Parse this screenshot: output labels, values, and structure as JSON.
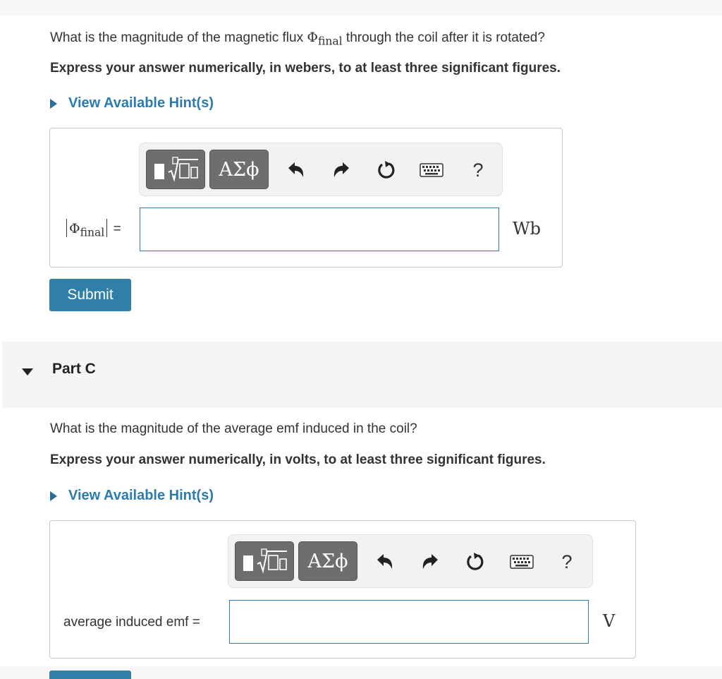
{
  "partB": {
    "question_before": "What is the magnitude of the magnetic flux ",
    "question_symbol": "Φ",
    "question_sub": "final",
    "question_after": " through the coil after it is rotated?",
    "instruction": "Express your answer numerically, in webers, to at least three significant figures.",
    "hint_label": "View Available Hint(s)",
    "toolbar": {
      "symbols_label": "ΑΣϕ",
      "help_label": "?"
    },
    "answer_label": {
      "symbol": "Φ",
      "sub": "final",
      "equals": "="
    },
    "input_value": "",
    "unit": "Wb",
    "submit_label": "Submit"
  },
  "partC": {
    "header": "Part C",
    "question": "What is the magnitude of the average emf induced in the coil?",
    "instruction": "Express your answer numerically, in volts, to at least three significant figures.",
    "hint_label": "View Available Hint(s)",
    "toolbar": {
      "symbols_label": "ΑΣϕ",
      "help_label": "?"
    },
    "answer_label": "average induced emf =",
    "input_value": "",
    "unit": "V"
  },
  "colors": {
    "link": "#2b7bb0",
    "submit_bg": "#2f7fa8",
    "input_border": "#2b7bb0",
    "toolbar_button": "#6e6e6e"
  },
  "icons": [
    "templates-icon",
    "undo-icon",
    "redo-icon",
    "reset-icon",
    "keyboard-icon"
  ]
}
